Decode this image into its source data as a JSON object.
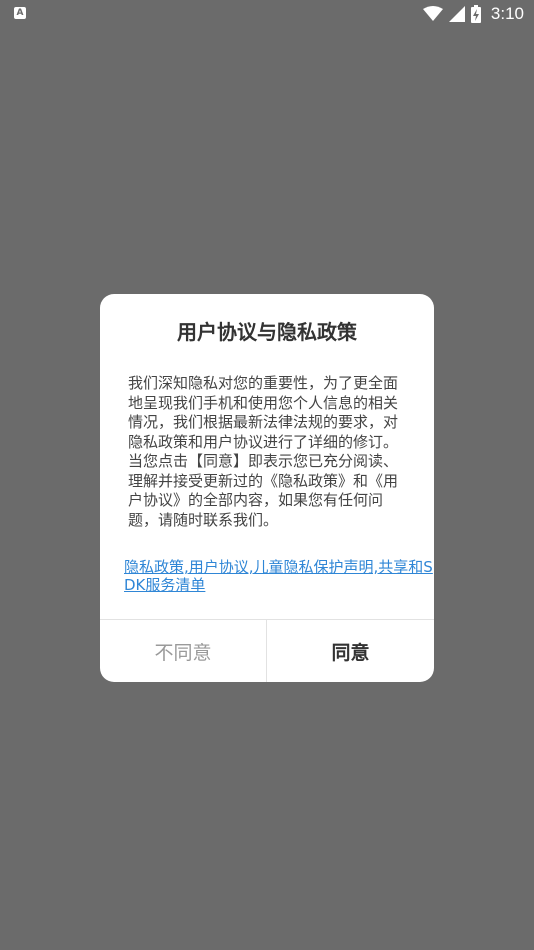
{
  "status_bar": {
    "notification_icon": "A",
    "time": "3:10",
    "icons": [
      "wifi-icon",
      "cell-signal-icon",
      "battery-charging-icon"
    ]
  },
  "dialog": {
    "title": "用户协议与隐私政策",
    "body": "我们深知隐私对您的重要性，为了更全面地呈现我们手机和使用您个人信息的相关情况，我们根据最新法律法规的要求，对隐私政策和用户协议进行了详细的修订。当您点击【同意】即表示您已充分阅读、理解并接受更新过的《隐私政策》和《用户协议》的全部内容，如果您有任何问题，请随时联系我们。",
    "links": "隐私政策,用户协议,儿童隐私保护声明,共享和SDK服务清单",
    "disagree_label": "不同意",
    "agree_label": "同意"
  },
  "colors": {
    "backdrop": "#6b6b6b",
    "link": "#2f86d6",
    "disagree_text": "#9a9a9a",
    "agree_text": "#333333"
  }
}
